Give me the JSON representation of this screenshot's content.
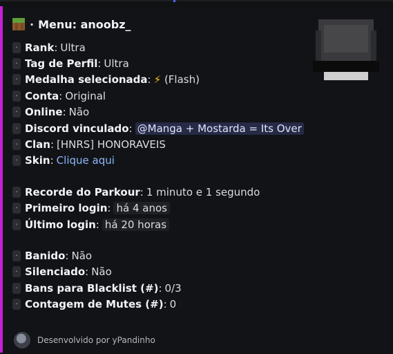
{
  "embed": {
    "title_text": "Menu: anoobz_",
    "title_icon": "grass-block-icon",
    "accent_color": "#c521d6",
    "bullet_glyph": "·"
  },
  "fields": {
    "rank": {
      "label": "Rank",
      "value": "Ultra"
    },
    "tag": {
      "label": "Tag de Perfil",
      "value": "Ultra"
    },
    "medal": {
      "label": "Medalha selecionada",
      "emoji": "⚡",
      "value": "(Flash)"
    },
    "account": {
      "label": "Conta",
      "value": "Original"
    },
    "online": {
      "label": "Online",
      "value": "Não"
    },
    "discord": {
      "label": "Discord vinculado",
      "value": "@Manga + Mostarda = Its Over"
    },
    "clan": {
      "label": "Clan",
      "value": "[HNRS] HONORAVEIS"
    },
    "skin": {
      "label": "Skin",
      "value": "Clique aqui"
    },
    "parkour": {
      "label": "Recorde do Parkour",
      "value": "1 minuto e 1 segundo"
    },
    "first_login": {
      "label": "Primeiro login",
      "value": "há 4 anos"
    },
    "last_login": {
      "label": "Último login",
      "value": "há 20 horas"
    },
    "banned": {
      "label": "Banido",
      "value": "Não"
    },
    "muted": {
      "label": "Silenciado",
      "value": "Não"
    },
    "bans_blacklist": {
      "label": "Bans para Blacklist (#)",
      "value": "0/3"
    },
    "mute_count": {
      "label": "Contagem de Mutes (#)",
      "value": "0"
    }
  },
  "footer": {
    "text": "Desenvolvido por yPandinho"
  },
  "colors": {
    "background": "#111214",
    "link": "#8eb8ff",
    "mention_bg": "#262a45"
  }
}
